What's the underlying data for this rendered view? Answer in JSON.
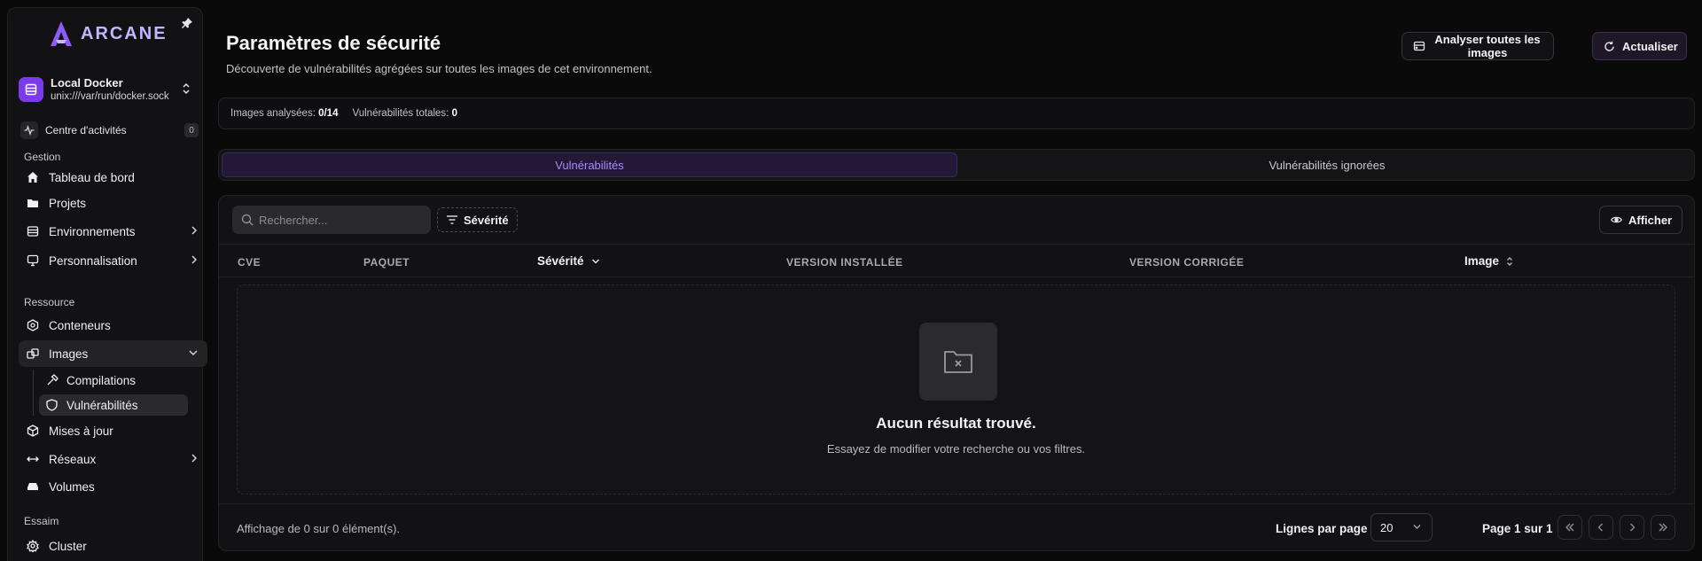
{
  "sidebar": {
    "brand": "ARCANE",
    "environment": {
      "name": "Local Docker",
      "socket": "unix:///var/run/docker.sock"
    },
    "activity": {
      "label": "Centre d'activités",
      "count": "0"
    },
    "sections": {
      "gestion": "Gestion",
      "ressource": "Ressource",
      "essaim": "Essaim"
    },
    "items": {
      "dashboard": "Tableau de bord",
      "projects": "Projets",
      "environments": "Environnements",
      "personalization": "Personnalisation",
      "containers": "Conteneurs",
      "images": "Images",
      "builds": "Compilations",
      "vulnerabilities": "Vulnérabilités",
      "updates": "Mises à jour",
      "networks": "Réseaux",
      "volumes": "Volumes",
      "cluster": "Cluster"
    }
  },
  "header": {
    "title": "Paramètres de sécurité",
    "subtitle": "Découverte de vulnérabilités agrégées sur toutes les images de cet environnement.",
    "analyze_label": "Analyser toutes les images",
    "refresh_label": "Actualiser"
  },
  "stats": {
    "analyzed_label": "Images analysées:",
    "analyzed_value": "0/14",
    "total_label": "Vulnérabilités totales:",
    "total_value": "0"
  },
  "tabs": {
    "vulnerabilities": "Vulnérabilités",
    "ignored": "Vulnérabilités ignorées"
  },
  "toolbar": {
    "search_placeholder": "Rechercher...",
    "severity_filter": "Sévérité",
    "show_label": "Afficher"
  },
  "table": {
    "columns": {
      "cve": "CVE",
      "package": "PAQUET",
      "severity": "Sévérité",
      "installed": "VERSION INSTALLÉE",
      "fixed": "VERSION CORRIGÉE",
      "image": "Image"
    },
    "empty_title": "Aucun résultat trouvé.",
    "empty_subtitle": "Essayez de modifier votre recherche ou vos filtres."
  },
  "pagination": {
    "count_text": "Affichage de 0 sur 0 élément(s).",
    "rows_per_page_label": "Lignes par page",
    "rows_per_page_value": "20",
    "page_info": "Page 1 sur 1"
  },
  "colors": {
    "accent": "#7c3aed",
    "accent_text": "#a78bfa",
    "background": "#0a0a0b",
    "panel": "#121214"
  }
}
